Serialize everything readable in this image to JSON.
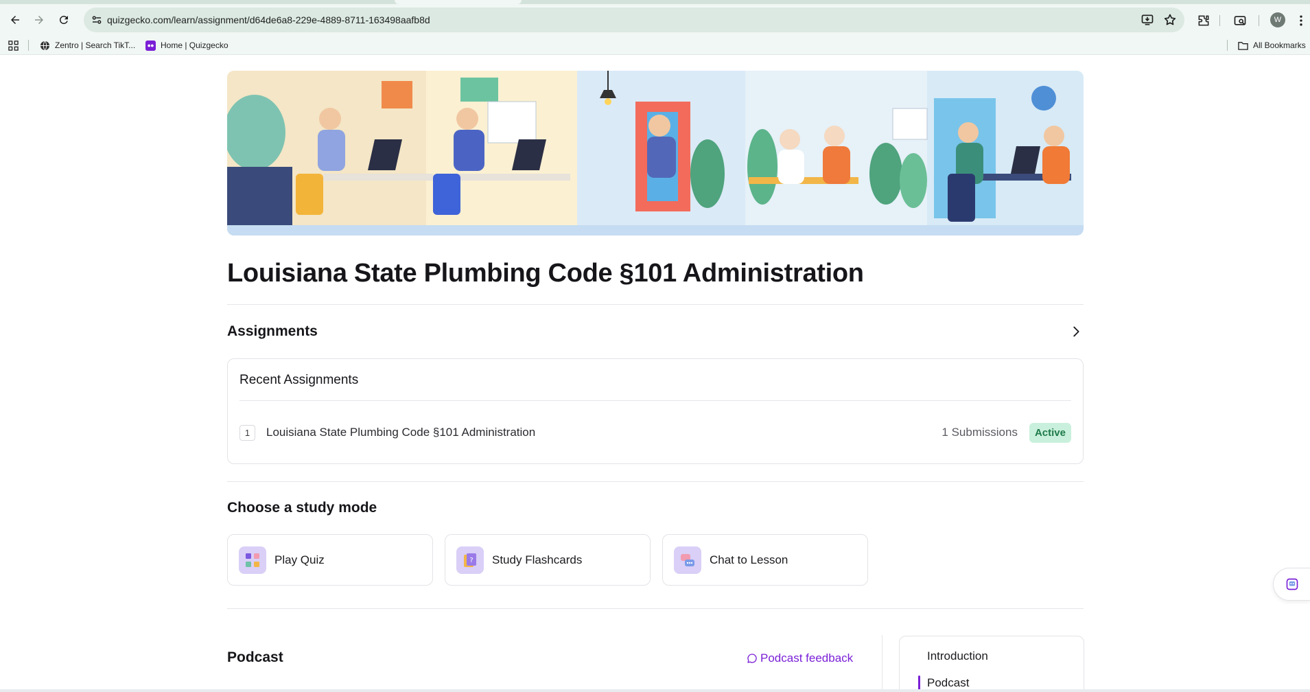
{
  "browser": {
    "url": "quizgecko.com/learn/assignment/d64de6a8-229e-4889-8711-163498aafb8d",
    "profile_initial": "W",
    "bookmarks": [
      {
        "label": "Zentro | Search TikT...",
        "icon": "globe-icon"
      },
      {
        "label": "Home | Quizgecko",
        "icon": "quizgecko-icon"
      }
    ],
    "all_bookmarks_label": "All Bookmarks"
  },
  "page": {
    "title": "Louisiana State Plumbing Code §101 Administration",
    "assignments": {
      "heading": "Assignments",
      "card_title": "Recent Assignments",
      "rows": [
        {
          "number": "1",
          "name": "Louisiana State Plumbing Code §101 Administration",
          "submissions": "1 Submissions",
          "status": "Active"
        }
      ]
    },
    "study_mode": {
      "heading": "Choose a study mode",
      "modes": [
        {
          "label": "Play Quiz",
          "icon": "quiz-grid-icon"
        },
        {
          "label": "Study Flashcards",
          "icon": "flashcard-icon"
        },
        {
          "label": "Chat to Lesson",
          "icon": "chat-icon"
        }
      ]
    },
    "podcast": {
      "heading": "Podcast",
      "feedback_label": "Podcast feedback",
      "toc": [
        "Introduction",
        "Podcast"
      ]
    }
  },
  "colors": {
    "accent_purple": "#7a1fd6",
    "active_badge_bg": "#c9f0dc",
    "active_badge_text": "#1d7a4a",
    "mode_icon_bg": "#d9cff7"
  }
}
